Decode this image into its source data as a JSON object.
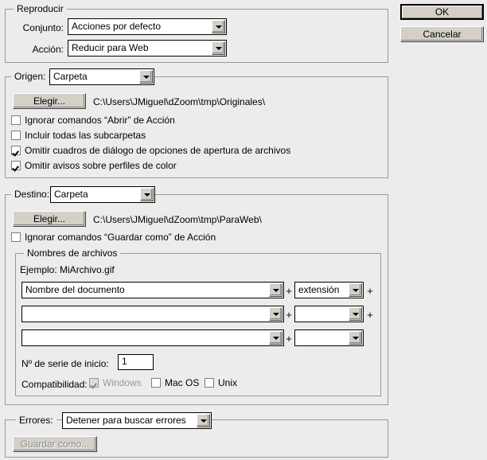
{
  "dialog": {
    "buttons": {
      "ok": "OK",
      "cancel": "Cancelar"
    }
  },
  "play_section": {
    "legend": "Reproducir",
    "set_label": "Conjunto:",
    "set_value": "Acciones por defecto",
    "action_label": "Acción:",
    "action_value": "Reducir para Web"
  },
  "source_section": {
    "legend": "Origen:",
    "source_value": "Carpeta",
    "choose_button": "Elegir...",
    "path": "C:\\Users\\JMiguel\\dZoom\\tmp\\Originales\\",
    "options": [
      {
        "label": "Ignorar comandos “Abrir” de Acción",
        "checked": false
      },
      {
        "label": "Incluir todas las subcarpetas",
        "checked": false
      },
      {
        "label": "Omitir cuadros de diálogo de opciones de apertura de archivos",
        "checked": true
      },
      {
        "label": "Omitir avisos sobre perfiles de color",
        "checked": true
      }
    ]
  },
  "destination_section": {
    "legend": "Destino:",
    "destination_value": "Carpeta",
    "choose_button": "Elegir...",
    "path": "C:\\Users\\JMiguel\\dZoom\\tmp\\ParaWeb\\",
    "ignore_save_as": {
      "label": "Ignorar comandos “Guardar como” de Acción",
      "checked": false
    },
    "file_naming": {
      "legend": "Nombres de archivos",
      "example_label": "Ejemplo: MiArchivo.gif",
      "rows": [
        {
          "left": "Nombre del documento",
          "right": "extensión",
          "plus_left": "+",
          "plus_right": "+"
        },
        {
          "left": "",
          "right": "",
          "plus_left": "+",
          "plus_right": "+"
        },
        {
          "left": "",
          "right": "",
          "plus_left": "+",
          "plus_right": ""
        }
      ],
      "serial_label": "Nº de serie de inicio:",
      "serial_value": "1",
      "compatibility_label": "Compatibilidad:",
      "compatibility": [
        {
          "label": "Windows",
          "checked": true,
          "disabled": true
        },
        {
          "label": "Mac OS",
          "checked": false,
          "disabled": false
        },
        {
          "label": "Unix",
          "checked": false,
          "disabled": false
        }
      ]
    }
  },
  "errors_section": {
    "legend": "Errores:",
    "errors_value": "Detener para buscar errores",
    "save_as_button": "Guardar como...",
    "save_as_disabled": true
  },
  "icons": {
    "dropdown_arrow": "chevron-down-icon"
  },
  "colors": {
    "background": "#ececec",
    "button_face": "#d4d0c8",
    "field": "#ffffff",
    "border": "#000000",
    "group_border": "#9a9a9a",
    "disabled_text": "#868686"
  }
}
